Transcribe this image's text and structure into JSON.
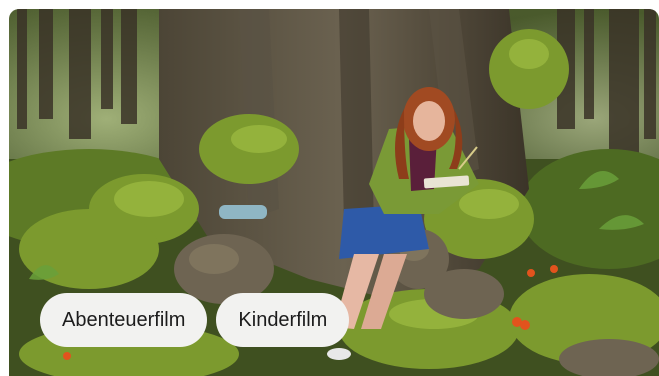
{
  "tags": [
    {
      "label": "Abenteuerfilm"
    },
    {
      "label": "Kinderfilm"
    }
  ],
  "colors": {
    "tag_background": "#f2f2f0",
    "tag_text": "#1c1c1c",
    "forest_dark": "#2f3a1f",
    "moss": "#6f8a2a",
    "jacket": "#7a9a36",
    "skirt": "#2e5aa8",
    "hair": "#a14a22"
  }
}
